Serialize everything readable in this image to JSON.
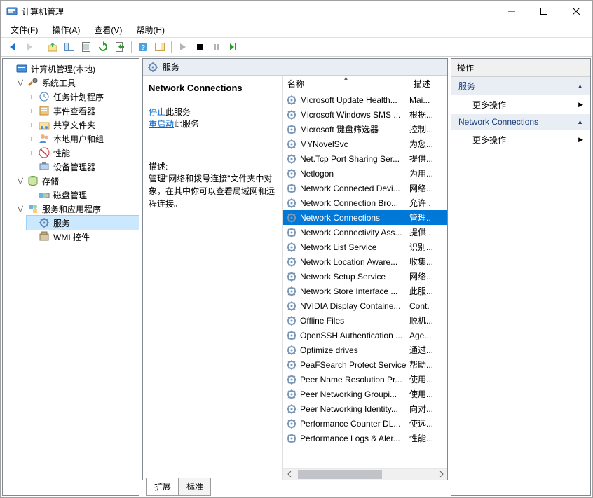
{
  "window": {
    "title": "计算机管理"
  },
  "menubar": [
    {
      "label": "文件(F)"
    },
    {
      "label": "操作(A)"
    },
    {
      "label": "查看(V)"
    },
    {
      "label": "帮助(H)"
    }
  ],
  "tree": {
    "root": "计算机管理(本地)",
    "system_tools": "系统工具",
    "task_scheduler": "任务计划程序",
    "event_viewer": "事件查看器",
    "shared_folders": "共享文件夹",
    "local_users": "本地用户和组",
    "performance": "性能",
    "device_manager": "设备管理器",
    "storage": "存储",
    "disk_management": "磁盘管理",
    "services_apps": "服务和应用程序",
    "services": "服务",
    "wmi_control": "WMI 控件"
  },
  "mid_header": "服务",
  "detail": {
    "title": "Network Connections",
    "stop_link": "停止",
    "stop_suffix": "此服务",
    "restart_link": "重启动",
    "restart_suffix": "此服务",
    "desc_label": "描述:",
    "desc_body": "管理\"网络和拨号连接\"文件夹中对象，在其中你可以查看局域网和远程连接。"
  },
  "columns": {
    "name": "名称",
    "desc": "描述"
  },
  "services": [
    {
      "name": "Microsoft Update Health...",
      "desc": "Mai..."
    },
    {
      "name": "Microsoft Windows SMS ...",
      "desc": "根据..."
    },
    {
      "name": "Microsoft 键盘筛选器",
      "desc": "控制..."
    },
    {
      "name": "MYNovelSvc",
      "desc": "为您..."
    },
    {
      "name": "Net.Tcp Port Sharing Ser...",
      "desc": "提供..."
    },
    {
      "name": "Netlogon",
      "desc": "为用..."
    },
    {
      "name": "Network Connected Devi...",
      "desc": "网络..."
    },
    {
      "name": "Network Connection Bro...",
      "desc": "允许 ."
    },
    {
      "name": "Network Connections",
      "desc": "管理..",
      "selected": true
    },
    {
      "name": "Network Connectivity Ass...",
      "desc": "提供 ."
    },
    {
      "name": "Network List Service",
      "desc": "识别..."
    },
    {
      "name": "Network Location Aware...",
      "desc": "收集..."
    },
    {
      "name": "Network Setup Service",
      "desc": "网络..."
    },
    {
      "name": "Network Store Interface ...",
      "desc": "此服..."
    },
    {
      "name": "NVIDIA Display Containe...",
      "desc": "Cont."
    },
    {
      "name": "Offline Files",
      "desc": "脱机..."
    },
    {
      "name": "OpenSSH Authentication ...",
      "desc": "Age..."
    },
    {
      "name": "Optimize drives",
      "desc": "通过..."
    },
    {
      "name": "PeaFSearch Protect Service",
      "desc": "帮助..."
    },
    {
      "name": "Peer Name Resolution Pr...",
      "desc": "使用..."
    },
    {
      "name": "Peer Networking Groupi...",
      "desc": "使用..."
    },
    {
      "name": "Peer Networking Identity...",
      "desc": "向对..."
    },
    {
      "name": "Performance Counter DL...",
      "desc": "使远..."
    },
    {
      "name": "Performance Logs & Aler...",
      "desc": "性能..."
    }
  ],
  "tabs": {
    "extended": "扩展",
    "standard": "标准"
  },
  "actions_panel": {
    "header": "操作",
    "section1": "服务",
    "more": "更多操作",
    "section2": "Network Connections"
  }
}
